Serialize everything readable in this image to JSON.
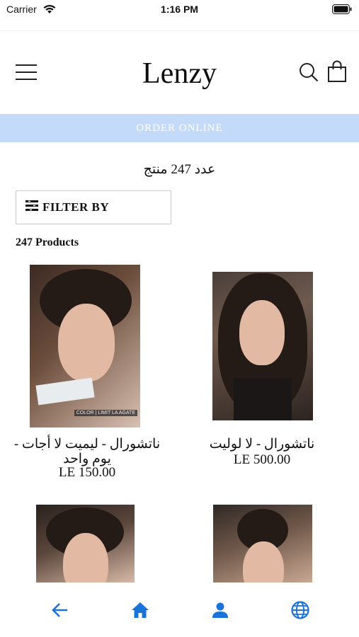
{
  "status_bar": {
    "carrier": "Carrier",
    "time": "1:16 PM",
    "wifi_icon": "wifi-icon",
    "battery_icon": "battery-icon"
  },
  "header": {
    "brand": "Lenzy",
    "menu_icon": "hamburger-menu-icon",
    "search_icon": "search-icon",
    "cart_icon": "shopping-bag-icon"
  },
  "banner": {
    "label": "ORDER ONLINE",
    "color": "#c3dbf8"
  },
  "collection": {
    "count_heading": "عدد 247 منتج",
    "filter_label": "FILTER BY",
    "products_count": "247 Products"
  },
  "products": [
    {
      "title": "ناتشورال - ليميت لا أجات - يوم واحد",
      "price": "LE 150.00",
      "image_tag": "COLOR | LIMIT LA AGATE"
    },
    {
      "title": "ناتشورال - لا لوليت",
      "price": "LE 500.00"
    },
    {
      "title": "",
      "price": ""
    },
    {
      "title": "",
      "price": ""
    }
  ],
  "tab_bar": {
    "accent": "#1a73d9",
    "items": [
      "back-arrow-icon",
      "home-icon",
      "user-icon",
      "globe-icon"
    ]
  }
}
